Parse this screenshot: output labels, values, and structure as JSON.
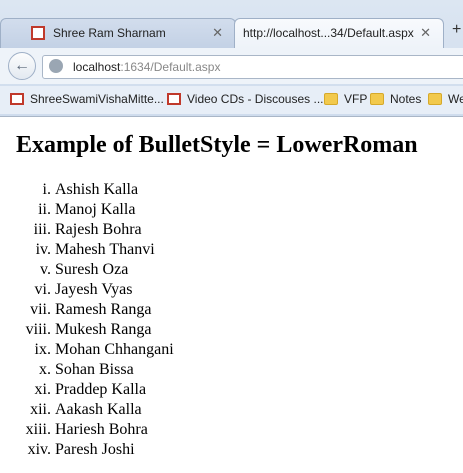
{
  "tabs": [
    {
      "title": "Shree Ram Sharnam",
      "close": "✕"
    },
    {
      "title": "http://localhost...34/Default.aspx",
      "close": "✕"
    }
  ],
  "new_tab_label": "+",
  "address": {
    "host": "localhost",
    "rest": ":1634/Default.aspx"
  },
  "bookmarks": [
    {
      "label": "ShreeSwamiVishaMitte...",
      "icon": "page-icon"
    },
    {
      "label": "Video CDs - Discouses ...",
      "icon": "page-icon"
    },
    {
      "label": "VFP",
      "icon": "folder-icon"
    },
    {
      "label": "Notes",
      "icon": "folder-icon"
    },
    {
      "label": "We",
      "icon": "folder-icon"
    }
  ],
  "heading": "Example of BulletStyle = LowerRoman",
  "list": [
    {
      "num": "i.",
      "name": "Ashish Kalla"
    },
    {
      "num": "ii.",
      "name": "Manoj Kalla"
    },
    {
      "num": "iii.",
      "name": "Rajesh Bohra"
    },
    {
      "num": "iv.",
      "name": "Mahesh Thanvi"
    },
    {
      "num": "v.",
      "name": "Suresh Oza"
    },
    {
      "num": "vi.",
      "name": "Jayesh Vyas"
    },
    {
      "num": "vii.",
      "name": "Ramesh Ranga"
    },
    {
      "num": "viii.",
      "name": "Mukesh Ranga"
    },
    {
      "num": "ix.",
      "name": "Mohan Chhangani"
    },
    {
      "num": "x.",
      "name": "Sohan Bissa"
    },
    {
      "num": "xi.",
      "name": "Praddep Kalla"
    },
    {
      "num": "xii.",
      "name": "Aakash Kalla"
    },
    {
      "num": "xiii.",
      "name": "Hariesh Bohra"
    },
    {
      "num": "xiv.",
      "name": "Paresh Joshi"
    }
  ]
}
